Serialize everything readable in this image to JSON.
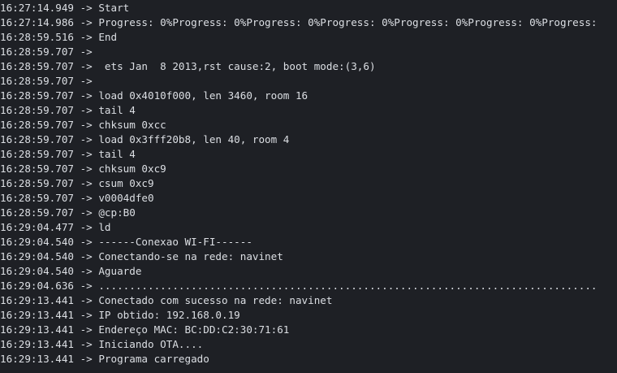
{
  "window": {
    "background": "#1e2025",
    "text_color": "#dcdfe4"
  },
  "separator": " -> ",
  "log": [
    {
      "ts": "16:27:14.949",
      "msg": "Start"
    },
    {
      "ts": "16:27:14.986",
      "msg": "Progress: 0%Progress: 0%Progress: 0%Progress: 0%Progress: 0%Progress: 0%Progress:"
    },
    {
      "ts": "16:28:59.516",
      "msg": "End"
    },
    {
      "ts": "16:28:59.707",
      "msg": ""
    },
    {
      "ts": "16:28:59.707",
      "msg": " ets Jan  8 2013,rst cause:2, boot mode:(3,6)"
    },
    {
      "ts": "16:28:59.707",
      "msg": ""
    },
    {
      "ts": "16:28:59.707",
      "msg": "load 0x4010f000, len 3460, room 16"
    },
    {
      "ts": "16:28:59.707",
      "msg": "tail 4"
    },
    {
      "ts": "16:28:59.707",
      "msg": "chksum 0xcc"
    },
    {
      "ts": "16:28:59.707",
      "msg": "load 0x3fff20b8, len 40, room 4"
    },
    {
      "ts": "16:28:59.707",
      "msg": "tail 4"
    },
    {
      "ts": "16:28:59.707",
      "msg": "chksum 0xc9"
    },
    {
      "ts": "16:28:59.707",
      "msg": "csum 0xc9"
    },
    {
      "ts": "16:28:59.707",
      "msg": "v0004dfe0"
    },
    {
      "ts": "16:28:59.707",
      "msg": "@cp:B0"
    },
    {
      "ts": "16:29:04.477",
      "msg": "ld"
    },
    {
      "ts": "16:29:04.540",
      "msg": "------Conexao WI-FI------"
    },
    {
      "ts": "16:29:04.540",
      "msg": "Conectando-se na rede: navinet"
    },
    {
      "ts": "16:29:04.540",
      "msg": "Aguarde"
    },
    {
      "ts": "16:29:04.636",
      "msg": "................................................................................."
    },
    {
      "ts": "16:29:13.441",
      "msg": "Conectado com sucesso na rede: navinet"
    },
    {
      "ts": "16:29:13.441",
      "msg": "IP obtido: 192.168.0.19"
    },
    {
      "ts": "16:29:13.441",
      "msg": "Endereço MAC: BC:DD:C2:30:71:61"
    },
    {
      "ts": "16:29:13.441",
      "msg": "Iniciando OTA...."
    },
    {
      "ts": "16:29:13.441",
      "msg": "Programa carregado"
    }
  ]
}
